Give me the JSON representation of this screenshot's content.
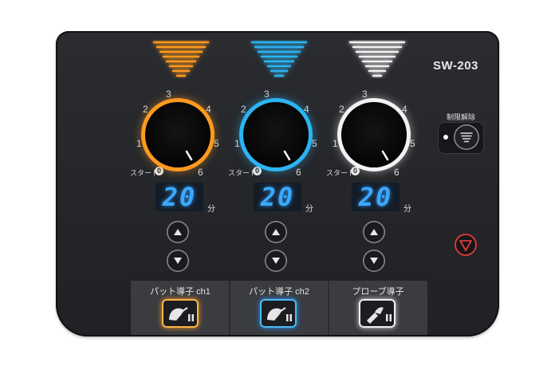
{
  "model": "SW-203",
  "scale_labels": [
    "1",
    "2",
    "3",
    "4",
    "5",
    "6"
  ],
  "start_label": "スタート",
  "zero_label": "0",
  "minute_unit": "分",
  "release": {
    "label": "制限解除"
  },
  "channels": [
    {
      "display": "20",
      "connector_label": "パット導子 ch1",
      "glow": "#ff9a1f"
    },
    {
      "display": "20",
      "connector_label": "パット導子 ch2",
      "glow": "#2cb4f2"
    },
    {
      "display": "20",
      "connector_label": "プローブ導子",
      "glow": "#f2f2f2"
    }
  ],
  "colors": {
    "panel": "#24262a",
    "display_digits": "#3aa8ff",
    "stop": "#e03a3a"
  },
  "icons": [
    "arrow-up-icon",
    "arrow-down-icon",
    "release-icon",
    "stop-icon",
    "pad-connector-icon",
    "probe-connector-icon"
  ]
}
